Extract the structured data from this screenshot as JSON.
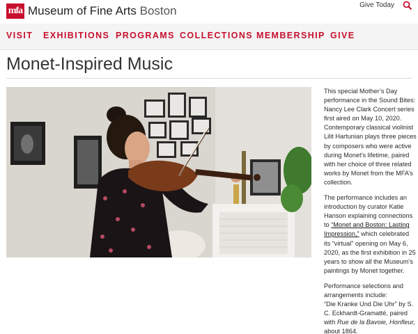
{
  "header": {
    "logo_mark": "mfa",
    "logo_name": "Museum of Fine Arts",
    "logo_city": "Boston",
    "give_today": "Give Today",
    "search_icon": "search-icon"
  },
  "nav": {
    "items": [
      {
        "label": "VISIT"
      },
      {
        "label": "EXHIBITIONS"
      },
      {
        "label": "PROGRAMS"
      },
      {
        "label": "COLLECTIONS"
      },
      {
        "label": "MEMBERSHIP"
      },
      {
        "label": "GIVE"
      }
    ]
  },
  "page": {
    "title": "Monet-Inspired Music"
  },
  "description": {
    "p1": "This special Mother’s Day performance in the Sound Bites: Nancy Lee Clark Concert series first aired on May 10, 2020. Contemporary classical violinist Lilit Hartunian plays three pieces by composers who were active during Monet’s lifetime, paired with her choice of three related works by Monet from the MFA’s collection.",
    "p2_before": "The performance includes an introduction by curator Katie Hanson explaining connections to ",
    "p2_link": "“Monet and Boston: Lasting Impression,”",
    "p2_after": " which celebrated its “virtual” opening on May 6, 2020, as the first exhibition in 25 years to show all the Museum’s paintings by Monet together.",
    "p3_line1": "Performance selections and arrangements include:",
    "p3_piece": "“Die Kranke Und Die Uhr” by S. C. Eckhardt-Gramatté, paired with ",
    "p3_work": "Rue de la Bavoie, Honfleur,",
    "p3_year": " about 1864."
  },
  "colors": {
    "brand_red": "#c8102e",
    "nav_bg": "#f4f4f4"
  }
}
